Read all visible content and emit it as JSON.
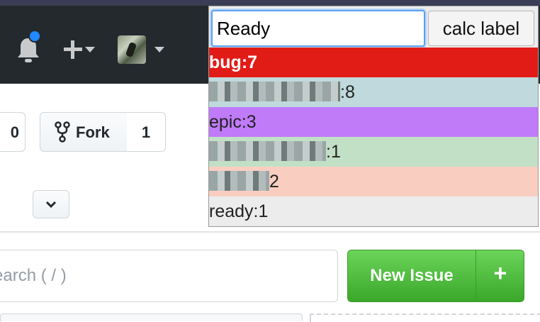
{
  "header": {
    "bell_icon": "bell-icon",
    "plus_icon": "plus-icon",
    "avatar_icon": "avatar"
  },
  "repo": {
    "left_counter": "0",
    "fork_label": "Fork",
    "fork_count": "1"
  },
  "issues": {
    "search_placeholder": "earch ( / )",
    "new_issue_label": "New Issue",
    "plus_label": "+"
  },
  "popup": {
    "input_value": "Ready",
    "button_label": "calc label",
    "labels": [
      {
        "text": "bug:7",
        "color": "#e11c17",
        "text_color": "#ffffff"
      },
      {
        "text": ":8",
        "color": "#bfd9dc",
        "text_color": "#222222",
        "redacted": true
      },
      {
        "text": "epic:3",
        "color": "#c07bf9",
        "text_color": "#222222"
      },
      {
        "text": ":1",
        "color": "#c2e0c6",
        "text_color": "#222222",
        "redacted": true
      },
      {
        "text": "2",
        "color": "#f9cec1",
        "text_color": "#222222",
        "redacted": true
      },
      {
        "text": "ready:1",
        "color": "#ececec",
        "text_color": "#222222"
      }
    ]
  }
}
